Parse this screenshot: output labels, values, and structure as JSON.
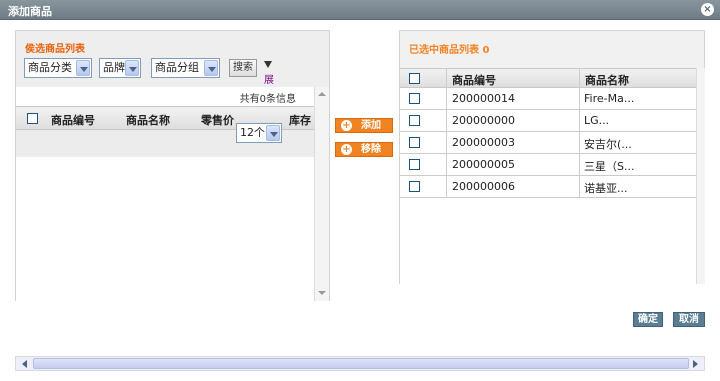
{
  "dialog": {
    "title": "添加商品",
    "close_icon": "close-icon"
  },
  "left_panel": {
    "title": "侯选商品列表",
    "filters": {
      "category": "商品分类",
      "brand": "品牌",
      "group": "商品分组",
      "search_label": "搜索",
      "expand_label": "展开"
    },
    "count_text": "共有0条信息",
    "columns": [
      "商品编号",
      "商品名称",
      "零售价",
      "库存"
    ],
    "page_size": "12个"
  },
  "middle": {
    "add_label": "添加",
    "remove_label": "移除"
  },
  "right_panel": {
    "title": "已选中商品列表 0",
    "columns": [
      "商品编号",
      "商品名称"
    ],
    "rows": [
      {
        "id": "200000014",
        "name": "Fire-Ma..."
      },
      {
        "id": "200000000",
        "name": "LG..."
      },
      {
        "id": "200000003",
        "name": "安吉尔(..."
      },
      {
        "id": "200000005",
        "name": "三星（S..."
      },
      {
        "id": "200000006",
        "name": "诺基亚..."
      }
    ]
  },
  "footer": {
    "confirm_label": "确定",
    "cancel_label": "取消"
  },
  "colors": {
    "accent": "#f08423",
    "title_bar": "#7d8a93",
    "button": "#5a7e93"
  }
}
